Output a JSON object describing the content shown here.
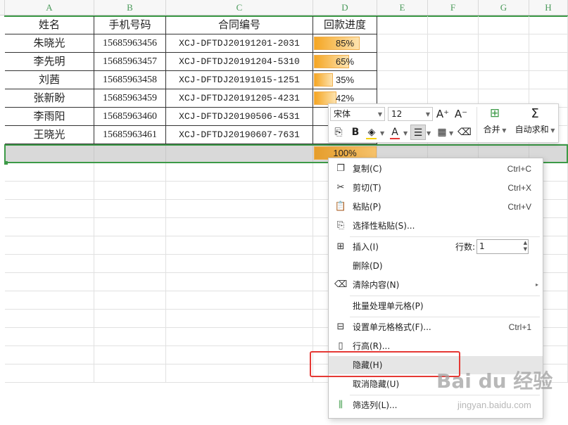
{
  "columns": [
    "A",
    "B",
    "C",
    "D",
    "E",
    "F",
    "G",
    "H"
  ],
  "headers": [
    "姓名",
    "手机号码",
    "合同编号",
    "回款进度"
  ],
  "rows": [
    {
      "name": "朱晓光",
      "phone": "15685963456",
      "contract": "XCJ-DFTDJ20191201-2031",
      "progress": "85%",
      "progress_value": 0.85
    },
    {
      "name": "李先明",
      "phone": "15685963457",
      "contract": "XCJ-DFTDJ20191204-5310",
      "progress": "65%",
      "progress_value": 0.65
    },
    {
      "name": "刘茜",
      "phone": "15685963458",
      "contract": "XCJ-DFTDJ20191015-1251",
      "progress": "35%",
      "progress_value": 0.35
    },
    {
      "name": "张新盼",
      "phone": "15685963459",
      "contract": "XCJ-DFTDJ20191205-4231",
      "progress": "42%",
      "progress_value": 0.42
    },
    {
      "name": "李雨阳",
      "phone": "15685963460",
      "contract": "XCJ-DFTDJ20190506-4531",
      "progress": "",
      "progress_value": 0.0
    },
    {
      "name": "王晓光",
      "phone": "15685963461",
      "contract": "XCJ-DFTDJ20190607-7631",
      "progress": "",
      "progress_value": 0.0
    }
  ],
  "selected_row": {
    "progress": "100%",
    "progress_value": 1.0
  },
  "toolbar": {
    "font_name": "宋体",
    "font_size": "12",
    "increase_font": "A⁺",
    "decrease_font": "A⁻",
    "merge_label": "合并",
    "autosum_label": "自动求和"
  },
  "menu": {
    "copy": {
      "label": "复制(C)",
      "shortcut": "Ctrl+C"
    },
    "cut": {
      "label": "剪切(T)",
      "shortcut": "Ctrl+X"
    },
    "paste": {
      "label": "粘贴(P)",
      "shortcut": "Ctrl+V"
    },
    "paste_special": {
      "label": "选择性粘贴(S)..."
    },
    "insert": {
      "label": "插入(I)",
      "rows_label": "行数:",
      "rows_value": "1"
    },
    "delete": {
      "label": "删除(D)"
    },
    "clear": {
      "label": "清除内容(N)"
    },
    "batch": {
      "label": "批量处理单元格(P)"
    },
    "format_cells": {
      "label": "设置单元格格式(F)...",
      "shortcut": "Ctrl+1"
    },
    "row_height": {
      "label": "行高(R)..."
    },
    "hide": {
      "label": "隐藏(H)"
    },
    "unhide": {
      "label": "取消隐藏(U)"
    },
    "filter_col": {
      "label": "筛选列(L)..."
    }
  },
  "watermark": {
    "brand": "Bai du 经验",
    "site": "jingyan.baidu.com"
  },
  "colors": {
    "accent_green": "#3c9a47",
    "highlight_red": "#e53935",
    "bar_orange": "#f5a623"
  }
}
